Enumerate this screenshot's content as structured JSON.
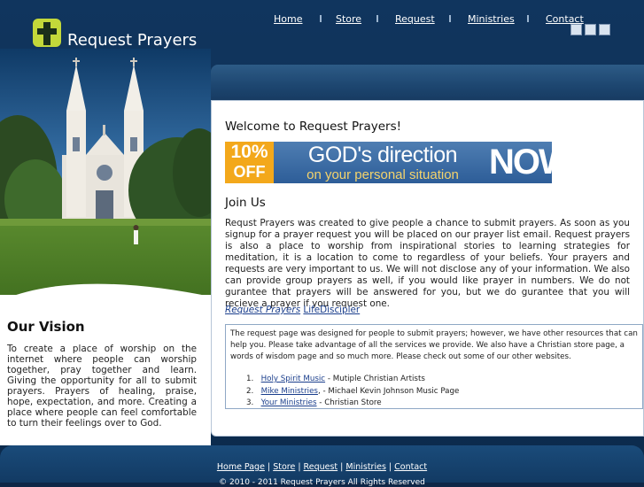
{
  "header": {
    "site_title": "Request Prayers",
    "logo_color": "#c3d83a",
    "utility_icons": [
      "home-icon",
      "mail-icon",
      "sitemap-icon"
    ]
  },
  "nav": {
    "items": [
      "Home",
      "Store",
      "Request",
      "Ministries",
      "Contact"
    ]
  },
  "sidebar": {
    "vision_title": "Our Vision",
    "vision_text": "To create a place of worship on the internet where people can worship together, pray together and learn. Giving the opportunity for all to submit prayers. Prayers of healing, praise, hope, expectation, and more. Creating a place where people can feel comfortable to turn their feelings over to God."
  },
  "main": {
    "welcome_title": "Welcome to Request Prayers!",
    "banner": {
      "percent": "10%",
      "off": "OFF",
      "line1": "GOD's direction",
      "line2": "on your personal situation",
      "now": "NOW"
    },
    "join_title": "Join Us",
    "join_text": "Requst Prayers was created to give people a chance to submit prayers. As soon as you signup for a prayer request you will be placed on our prayer list email. Request prayers is also a place to worship from inspirational stories to learning strategies for meditation, it is a location to come to regardless of your beliefs. Your prayers and requests are very important to us. We will not disclose any of your information. We also can provide group prayers as well, if you would like prayer in numbers. We do not gurantee that prayers will be answered for you, but we do gurantee that you will recieve a prayer if you request one.",
    "link_request_prayers": "Request Prayers",
    "link_life_discipler": "LifeDiscipler",
    "info_text": "The request page was designed for people to submit prayers; however, we have other resources that can help you. Please take advantage of all the services we provide. We also have a Christian store page, a words of wisdom page and so much more. Please check out some of our other websites.",
    "sites": [
      {
        "num": "1.",
        "name": "Holy Spirit Music",
        "desc": " - Mutiple Christian Artists"
      },
      {
        "num": "2.",
        "name": "Mike Ministries",
        "desc": ", - Michael Kevin Johnson Music Page"
      },
      {
        "num": "3.",
        "name": "Your Ministries",
        "desc": " - Christian Store"
      }
    ]
  },
  "footer": {
    "links": [
      "Home Page",
      "Store",
      "Request",
      "Ministries",
      "Contact"
    ],
    "separator": " | ",
    "copyright": "© 2010 - 2011 Request Prayers All Rights Reserved"
  }
}
